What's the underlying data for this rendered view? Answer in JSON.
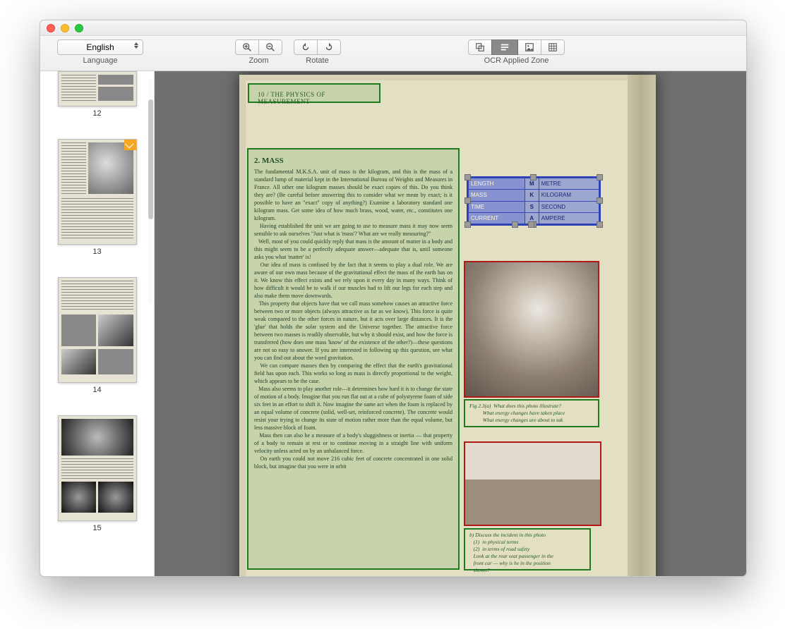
{
  "toolbar": {
    "language_label": "Language",
    "language_value": "English",
    "zoom_label": "Zoom",
    "rotate_label": "Rotate",
    "ocr_zone_label": "OCR Applied Zone"
  },
  "sidebar": {
    "thumbs": [
      {
        "num": "12"
      },
      {
        "num": "13"
      },
      {
        "num": "14"
      },
      {
        "num": "15"
      }
    ]
  },
  "page": {
    "running_head": "10 / THE PHYSICS OF MEASUREMENT",
    "section_title": "2. MASS",
    "body": "The fundamental M.K.S.A. unit of mass is the kilogram, and this is the mass of a standard lump of material kept in the International Bureau of Weights and Measures in France. All other one kilogram masses should be exact copies of this. Do you think they are? (Be careful before answering this to consider what we mean by exact; is it possible to have an \"exact\" copy of anything?) Examine a laboratory standard one kilogram mass. Get some idea of how much brass, wood, water, etc., constitutes one kilogram.\n   Having established the unit we are going to use to measure mass it may now seem sensible to ask ourselves \"Just what is 'mass'? What are we really measuring?\"\n   Well, most of you could quickly reply that mass is the amount of matter in a body and this might seem to be a perfectly adequate answer—adequate that is, until someone asks you what 'matter' is!\n   Our idea of mass is confused by the fact that it seems to play a dual role. We are aware of our own mass because of the gravitational effect the mass of the earth has on it. We know this effect exists and we rely upon it every day in many ways. Think of how difficult it would be to walk if our muscles had to lift our legs for each step and also make them move downwards.\n   This property that objects have that we call mass somehow causes an attractive force between two or more objects (always attractive as far as we know). This force is quite weak compared to the other forces in nature, but it acts over large distances. It is the 'glue' that holds the solar system and the Universe together. The attractive force between two masses is readily observable, but why it should exist, and how the force is transferred (how does one mass 'know' of the existence of the other?)—these questions are not so easy to answer. If you are interested in following up this question, see what you can find out about the word gravitation.\n   We can compare masses then by comparing the effect that the earth's gravitational field has upon each. This works so long as mass is directly proportional to the weight, which appears to be the case.\n   Mass also seems to play another role—it determines how hard it is to change the state of motion of a body. Imagine that you run flat out at a cube of polystyrene foam of side six feet in an effort to shift it. Now imagine the same act when the foam is replaced by an equal volume of concrete (solid, well-set, reinforced concrete). The concrete would resist your trying to change its state of motion rather more than the equal volume, but less massive block of foam.\n   Mass then can also be a measure of a body's sluggishness or inertia — that property of a body to remain at rest or to continue moving in a straight line with uniform velocity unless acted on by an unbalanced force.\n   On earth you could not move 216 cubic feet of concrete concentrated in one solid block, but imagine that you were in orbit",
    "table": {
      "rows": [
        {
          "label": "LENGTH",
          "sym": "M",
          "unit": "METRE"
        },
        {
          "label": "MASS",
          "sym": "K",
          "unit": "KILOGRAM"
        },
        {
          "label": "TIME",
          "sym": "S",
          "unit": "SECOND"
        },
        {
          "label": "CURRENT",
          "sym": "A",
          "unit": "AMPERE"
        }
      ]
    },
    "caption1": "Fig 2.3(a)  What does this photo illustrate?\n          What energy changes have taken place\n          What energy changes are about to tak",
    "caption2": "b) Discuss the incident in this photo\n   (1)  in physical terms\n   (2)  in terms of road safety\n   Look at the rear seat passenger in the\n   front car — why is he in the position\n   shown?"
  }
}
